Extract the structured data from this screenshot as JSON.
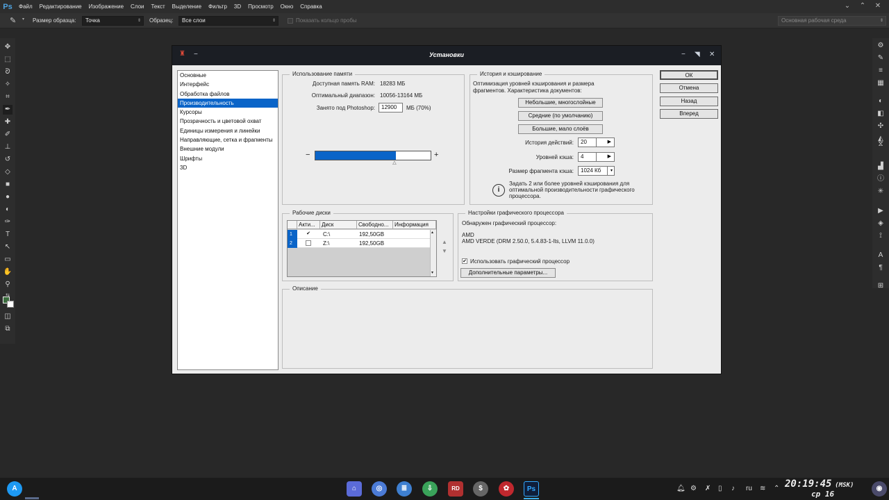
{
  "menubar": {
    "logo": "Ps",
    "items": [
      "Файл",
      "Редактирование",
      "Изображение",
      "Слои",
      "Текст",
      "Выделение",
      "Фильтр",
      "3D",
      "Просмотр",
      "Окно",
      "Справка"
    ]
  },
  "optbar": {
    "sample_size_label": "Размер образца:",
    "sample_size_value": "Точка",
    "sample_label": "Образец:",
    "sample_value": "Все слои",
    "ring_label": "Показать кольцо пробы",
    "workspace": "Основная рабочая среда"
  },
  "dialog": {
    "title": "Установки",
    "categories": [
      "Основные",
      "Интерфейс",
      "Обработка файлов",
      "Производительность",
      "Курсоры",
      "Прозрачность и цветовой охват",
      "Единицы измерения и линейки",
      "Направляющие, сетка и фрагменты",
      "Внешние модули",
      "Шрифты",
      "3D"
    ],
    "selected_category": 3,
    "memory": {
      "group_title": "Использование памяти",
      "ram_label": "Доступная память RAM:",
      "ram_value": "18283 МБ",
      "range_label": "Оптимальный диапазон:",
      "range_value": "10056-13164 МБ",
      "used_label": "Занято под Photoshop:",
      "used_value": "12900",
      "used_unit": "МБ (70%)",
      "slider_fraction": 0.7,
      "minus": "−",
      "plus": "+"
    },
    "history": {
      "group_title": "История и кэширование",
      "desc": "Оптимизация уровней кэширования и размера фрагментов. Характеристика документов:",
      "btn_small": "Небольшие, многослойные",
      "btn_medium": "Средние (по умолчанию)",
      "btn_large": "Большие, мало слоёв",
      "states_label": "История действий:",
      "states_value": "20",
      "cache_label": "Уровней кэша:",
      "cache_value": "4",
      "tile_label": "Размер фрагмента кэша:",
      "tile_value": "1024 Кб",
      "note": "Задать 2 или более уровней кэширования для оптимальной производительности графического процессора."
    },
    "disks": {
      "group_title": "Рабочие диски",
      "headers": [
        "Акти...",
        "Диск",
        "Свободно...",
        "Информация"
      ],
      "rows": [
        {
          "num": "1",
          "active": "✔",
          "disk": "C:\\",
          "free": "192,50GB",
          "info": ""
        },
        {
          "num": "2",
          "active": "",
          "disk": "Z:\\",
          "free": "192,50GB",
          "info": ""
        }
      ]
    },
    "gpu": {
      "group_title": "Настройки графического процессора",
      "detected_label": "Обнаружен графический процессор:",
      "vendor": "AMD",
      "model": "AMD VERDE (DRM 2.50.0, 5.4.83-1-lts, LLVM 11.0.0)",
      "use_label": "Использовать графический процессор",
      "advanced_btn": "Дополнительные параметры..."
    },
    "description": {
      "group_title": "Описание"
    },
    "buttons": {
      "ok": "ОК",
      "cancel": "Отмена",
      "prev": "Назад",
      "next": "Вперед"
    }
  },
  "taskbar": {
    "time": "20:19:45",
    "tz": "(MSK)",
    "date": "ср 16",
    "lang": "ru"
  }
}
